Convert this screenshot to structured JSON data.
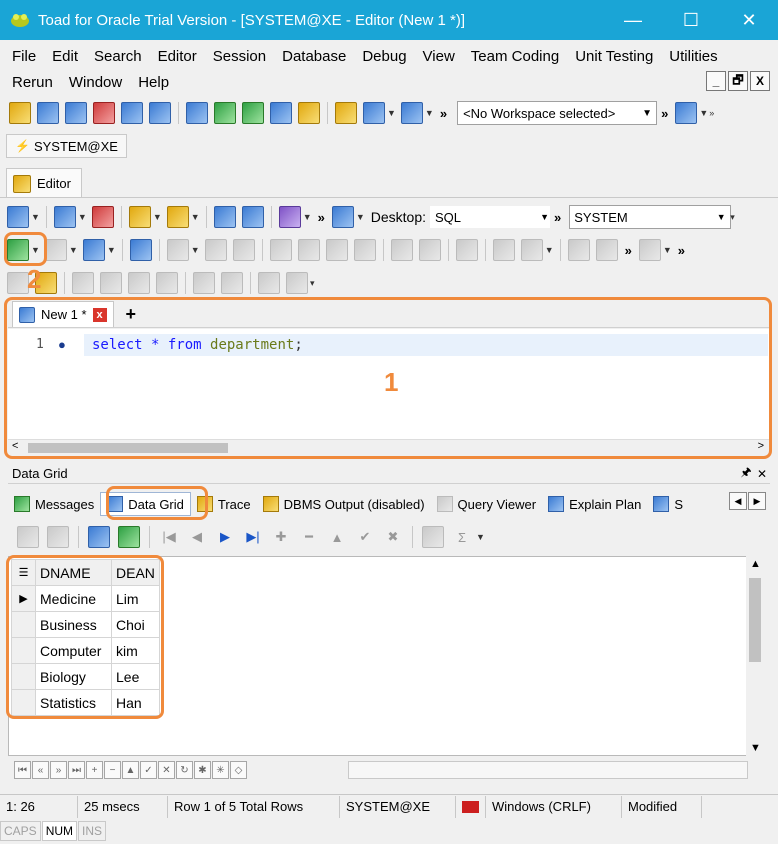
{
  "window": {
    "title": "Toad for Oracle Trial Version - [SYSTEM@XE - Editor (New 1 *)]",
    "minimize": "—",
    "maximize": "☐",
    "close": "✕"
  },
  "menu": {
    "row1": [
      "File",
      "Edit",
      "Search",
      "Editor",
      "Session",
      "Database",
      "Debug",
      "View",
      "Team Coding",
      "Unit Testing",
      "Utilities"
    ],
    "row2": [
      "Rerun",
      "Window",
      "Help"
    ],
    "mdi": [
      "_",
      "🗗",
      "X"
    ]
  },
  "toolbar_main": {
    "workspace": "<No Workspace selected>"
  },
  "connection_tab": "SYSTEM@XE",
  "editor_tab": "Editor",
  "editor_toolbar": {
    "desktop_label": "Desktop:",
    "desktop_value": "SQL",
    "schema_value": "SYSTEM"
  },
  "document": {
    "tab_label": "New 1 *",
    "add_tab": "+",
    "line_number": "1",
    "sql": {
      "kw1": "select",
      "star": " * ",
      "kw2": "from",
      "table": " department",
      "end": ";"
    }
  },
  "result_panel": {
    "title": "Data Grid",
    "tabs": [
      "Messages",
      "Data Grid",
      "Trace",
      "DBMS Output (disabled)",
      "Query Viewer",
      "Explain Plan",
      "S"
    ],
    "active_tab": "Data Grid"
  },
  "grid": {
    "columns": [
      "DNAME",
      "DEAN"
    ],
    "rows": [
      [
        "Medicine",
        "Lim"
      ],
      [
        "Business",
        "Choi"
      ],
      [
        "Computer",
        "kim"
      ],
      [
        "Biology",
        "Lee"
      ],
      [
        "Statistics",
        "Han"
      ]
    ]
  },
  "status": {
    "position": "1:  26",
    "time": "25 msecs",
    "rows": "Row 1 of 5 Total Rows",
    "connection": "SYSTEM@XE",
    "line_ending": "Windows (CRLF)",
    "state": "Modified"
  },
  "keys": [
    "CAPS",
    "NUM",
    "INS"
  ],
  "annotations": {
    "one": "1",
    "two": "2"
  },
  "colors": {
    "titlebar": "#1aa5d6",
    "highlight": "#f08a3c"
  }
}
